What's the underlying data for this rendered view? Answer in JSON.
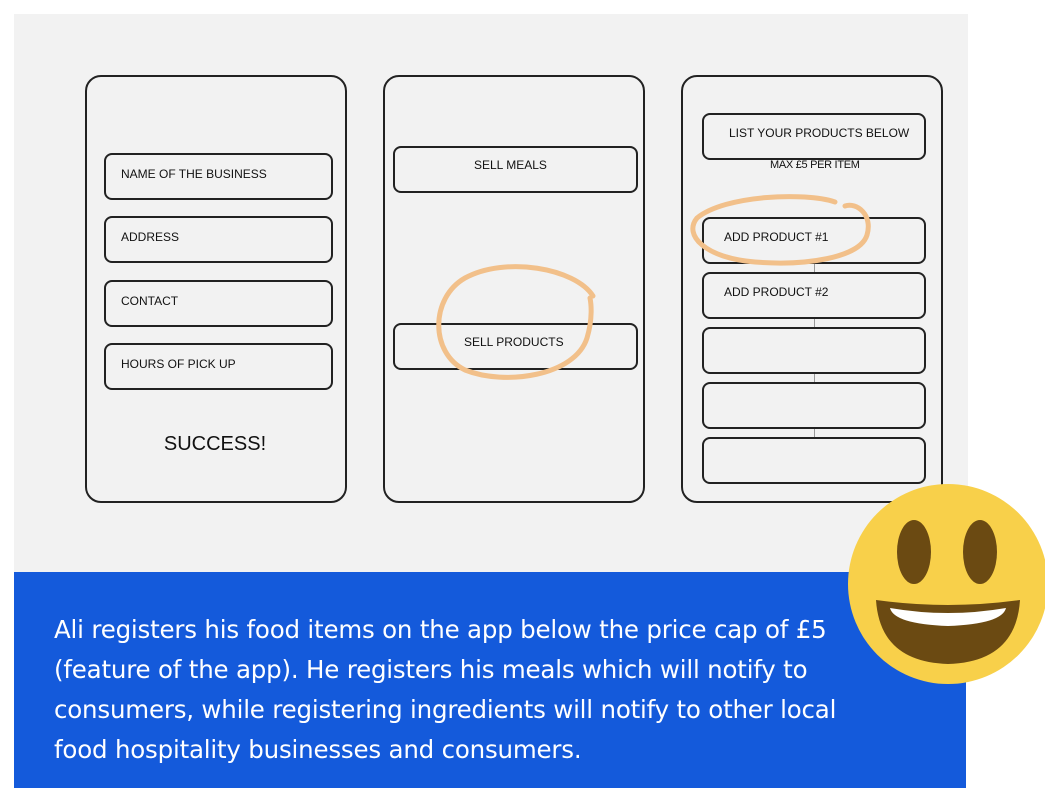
{
  "screen1": {
    "fields": [
      "NAME OF THE BUSINESS",
      "ADDRESS",
      "CONTACT",
      "HOURS OF PICK UP"
    ],
    "success": "SUCCESS!"
  },
  "screen2": {
    "sell_meals": "SELL MEALS",
    "sell_products": "SELL PRODUCTS"
  },
  "screen3": {
    "header": "LIST YOUR PRODUCTS BELOW",
    "note": "MAX £5 PER ITEM",
    "products": [
      "ADD PRODUCT #1",
      "ADD PRODUCT #2",
      "",
      "",
      ""
    ]
  },
  "caption": {
    "text": "Ali registers his food items on the app below the price cap of £5 (feature of the app). He registers his meals which will notify to consumers, while registering ingredients will notify to other local food hospitality businesses and consumers."
  },
  "colors": {
    "caption_bg": "#145adb",
    "highlight": "#f2c08a",
    "emoji_face": "#f8d04a"
  },
  "icons": [
    "smiley-emoji-icon"
  ]
}
